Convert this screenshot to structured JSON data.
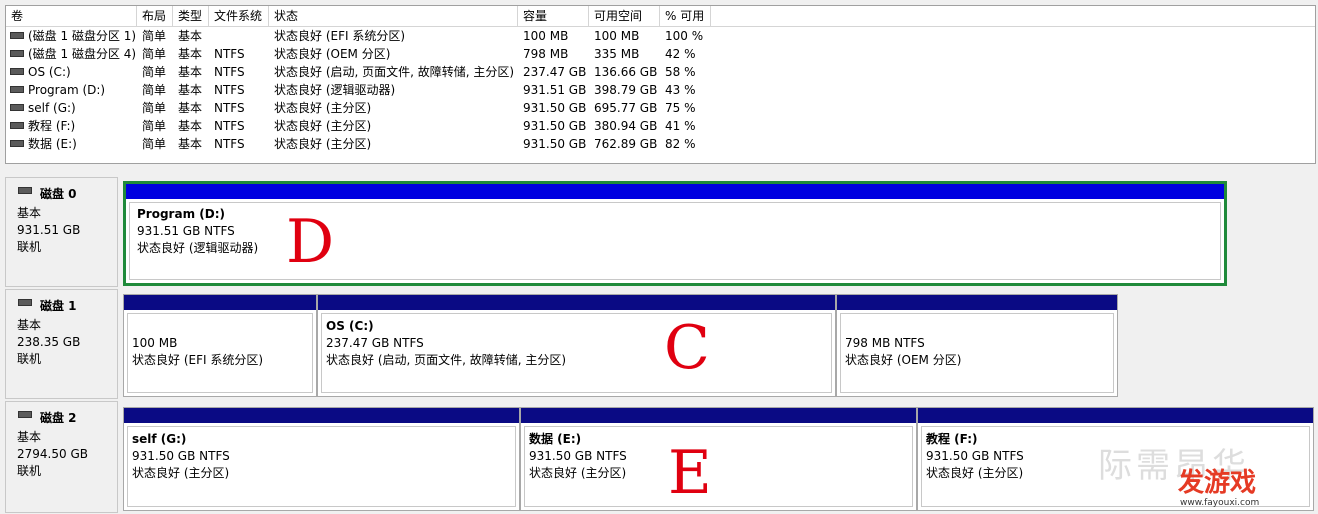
{
  "columns": [
    "卷",
    "布局",
    "类型",
    "文件系统",
    "状态",
    "容量",
    "可用空间",
    "% 可用"
  ],
  "volumes": [
    {
      "name": "(磁盘 1 磁盘分区 1)",
      "layout": "简单",
      "type": "基本",
      "fs": "",
      "status": "状态良好 (EFI 系统分区)",
      "capacity": "100 MB",
      "free": "100 MB",
      "pct": "100 %"
    },
    {
      "name": "(磁盘 1 磁盘分区 4)",
      "layout": "简单",
      "type": "基本",
      "fs": "NTFS",
      "status": "状态良好 (OEM 分区)",
      "capacity": "798 MB",
      "free": "335 MB",
      "pct": "42 %"
    },
    {
      "name": "OS (C:)",
      "layout": "简单",
      "type": "基本",
      "fs": "NTFS",
      "status": "状态良好 (启动, 页面文件, 故障转储, 主分区)",
      "capacity": "237.47 GB",
      "free": "136.66 GB",
      "pct": "58 %"
    },
    {
      "name": "Program (D:)",
      "layout": "简单",
      "type": "基本",
      "fs": "NTFS",
      "status": "状态良好 (逻辑驱动器)",
      "capacity": "931.51 GB",
      "free": "398.79 GB",
      "pct": "43 %"
    },
    {
      "name": "self (G:)",
      "layout": "简单",
      "type": "基本",
      "fs": "NTFS",
      "status": "状态良好 (主分区)",
      "capacity": "931.50 GB",
      "free": "695.77 GB",
      "pct": "75 %"
    },
    {
      "name": "教程 (F:)",
      "layout": "简单",
      "type": "基本",
      "fs": "NTFS",
      "status": "状态良好 (主分区)",
      "capacity": "931.50 GB",
      "free": "380.94 GB",
      "pct": "41 %"
    },
    {
      "name": "数据 (E:)",
      "layout": "简单",
      "type": "基本",
      "fs": "NTFS",
      "status": "状态良好 (主分区)",
      "capacity": "931.50 GB",
      "free": "762.89 GB",
      "pct": "82 %"
    }
  ],
  "disks": [
    {
      "title": "磁盘 0",
      "type": "基本",
      "size": "931.51 GB",
      "state": "联机",
      "partitions": [
        {
          "name": "Program  (D:)",
          "size_fs": "931.51 GB NTFS",
          "status": "状态良好 (逻辑驱动器)"
        }
      ]
    },
    {
      "title": "磁盘 1",
      "type": "基本",
      "size": "238.35 GB",
      "state": "联机",
      "partitions": [
        {
          "name": "",
          "size_fs": "100 MB",
          "status": "状态良好 (EFI 系统分区)"
        },
        {
          "name": "OS  (C:)",
          "size_fs": "237.47 GB NTFS",
          "status": "状态良好 (启动, 页面文件, 故障转储, 主分区)"
        },
        {
          "name": "",
          "size_fs": "798 MB NTFS",
          "status": "状态良好 (OEM 分区)"
        }
      ]
    },
    {
      "title": "磁盘 2",
      "type": "基本",
      "size": "2794.50 GB",
      "state": "联机",
      "partitions": [
        {
          "name": "self  (G:)",
          "size_fs": "931.50 GB NTFS",
          "status": "状态良好 (主分区)"
        },
        {
          "name": "数据  (E:)",
          "size_fs": "931.50 GB NTFS",
          "status": "状态良好 (主分区)"
        },
        {
          "name": "教程  (F:)",
          "size_fs": "931.50 GB NTFS",
          "status": "状态良好 (主分区)"
        }
      ]
    }
  ],
  "annotations": {
    "d": "D",
    "c": "C",
    "e": "E"
  },
  "watermark": {
    "logo": "发游戏",
    "url": "www.fayouxi.com",
    "faint": "际需昂华"
  },
  "colors": {
    "logical_bar": "#0000e0",
    "primary_bar": "#0a0a84",
    "selected_border": "#1f8a3a",
    "annotation": "#e00010"
  },
  "icons": {
    "volume": "drive-icon",
    "disk": "disk-icon"
  }
}
